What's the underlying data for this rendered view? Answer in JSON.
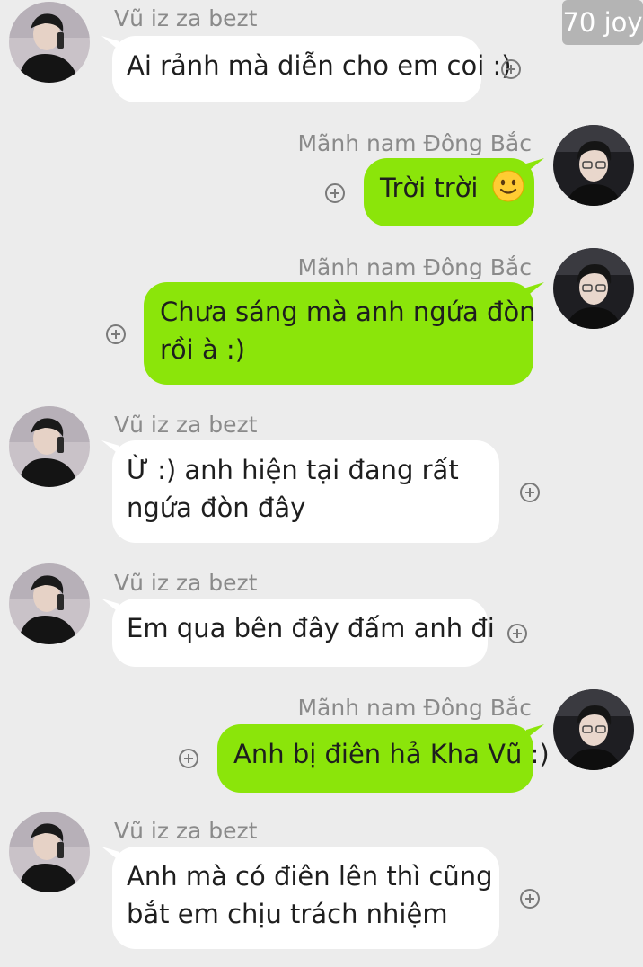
{
  "watermark": "70 joy",
  "messages": [
    {
      "sender": "Vũ iz za bezt",
      "lines": [
        "Ai rảnh mà diễn cho em coi :)"
      ]
    },
    {
      "sender": "Mãnh nam Đông Bắc",
      "lines": [
        "Trời trời"
      ],
      "emoji": "slightly-smiling-face-icon"
    },
    {
      "sender": "Mãnh nam Đông Bắc",
      "lines": [
        "Chưa sáng mà anh ngứa đòn",
        "rồi à :)"
      ]
    },
    {
      "sender": "Vũ iz za bezt",
      "lines": [
        "Ừ :) anh hiện tại đang rất",
        "ngứa đòn đây"
      ]
    },
    {
      "sender": "Vũ iz za bezt",
      "lines": [
        "Em qua bên đây đấm anh đi"
      ]
    },
    {
      "sender": "Mãnh nam Đông Bắc",
      "lines": [
        "Anh bị điên hả Kha Vũ :)"
      ]
    },
    {
      "sender": "Vũ iz za bezt",
      "lines": [
        "Anh mà có điên lên thì cũng",
        "bắt em chịu trách nhiệm"
      ]
    }
  ],
  "colors": {
    "incoming_bubble": "#ffffff",
    "outgoing_bubble": "#8be50a",
    "background": "#ececec"
  }
}
